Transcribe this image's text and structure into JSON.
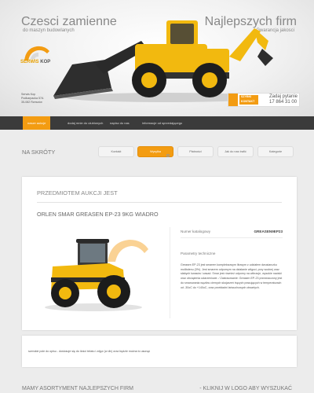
{
  "header": {
    "title_left": "Czesci zamienne",
    "subtitle_left": "do maszyn budowlanych",
    "title_right": "Najlepszych firm",
    "subtitle_right": "Gwarancja jakosci",
    "logo_text_a": "SERWIS",
    "logo_text_b": "KOP",
    "address": [
      "Serwis Kop",
      "Podkarpacka 57A",
      "35-082 Rzeszów"
    ],
    "contact": {
      "label": "SZYBKI KONTAKT",
      "ask": "Zadaj pytanie",
      "phone": "17 864 31 00"
    }
  },
  "nav": {
    "items": [
      {
        "label": "nasze aukcje",
        "active": true
      },
      {
        "label": "dodaj mnie do ulubionych",
        "active": false
      },
      {
        "label": "napisz do nas",
        "active": false
      },
      {
        "label": "informacje od sprzedającego",
        "active": false
      }
    ]
  },
  "shortcuts": {
    "label": "NA SKRÓTY",
    "items": [
      {
        "label": "Kontakt",
        "active": false
      },
      {
        "label": "Wysyłka",
        "active": true
      },
      {
        "label": "Płatności",
        "active": false
      },
      {
        "label": "Jak do nas trafić",
        "active": false
      },
      {
        "label": "Kategorie",
        "active": false
      }
    ]
  },
  "auction": {
    "heading": "PRZEDMIOTEM AUKCJI JEST",
    "product_title": "ORLEN SMAR GREASEN EP-23 9KG WIADRO",
    "catalog_label": "Numer katalogowy",
    "catalog_value": "GREASEN9EP23",
    "params_label": "Parametry techniczne",
    "description": "Greasen EP-23 jest smarem kompleksowym litowym z udziałem dwusiarczku molibdenu (3%). Jest smarem odpornym na działanie wilgoci, przy wodnej oraz słabych kwasów i zasad. Smar jest również odporny na wibracje, wysokie naciski oraz obciążenia udarzeniowe. / Zastosowanie: Greasen EP-23 przeznaczony jest do smarowania węzłów ciernych skojarzeń trących pracujących w temperaturach od -30oC do +140oC, oraz przekładni łańcuchowych otwartych."
  },
  "notice": {
    "text": "szerokie pole do opisu - dostosuje się do ilości tekstu i zdjęć (w div) oraz będzie można to usunąć"
  },
  "footer": {
    "left": "MAMY ASORTYMENT NAJLEPSZYCH FIRM",
    "right": "- KLIKNIJ W LOGO ABY WYSZUKAĆ"
  },
  "colors": {
    "accent": "#f39c12",
    "nav_bg": "#3b3b3b",
    "page_bg": "#ececec"
  }
}
